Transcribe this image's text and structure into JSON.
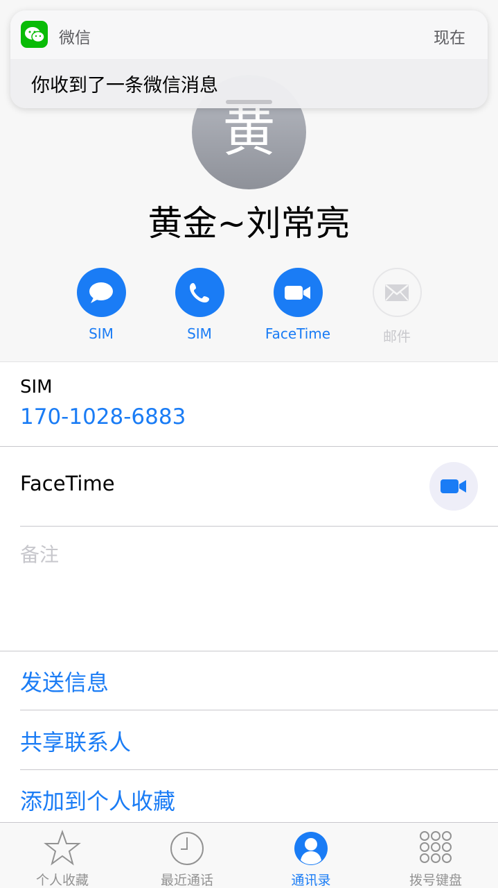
{
  "notification": {
    "app_name": "微信",
    "time": "现在",
    "message": "你收到了一条微信消息"
  },
  "contact": {
    "avatar_initial": "黄",
    "name": "黄金~刘常亮"
  },
  "quick_actions": [
    {
      "label": "SIM",
      "icon": "message-icon",
      "enabled": true
    },
    {
      "label": "SIM",
      "icon": "phone-icon",
      "enabled": true
    },
    {
      "label": "FaceTime",
      "icon": "video-camera-icon",
      "enabled": true
    },
    {
      "label": "邮件",
      "icon": "mail-icon",
      "enabled": false
    }
  ],
  "phone": {
    "type": "SIM",
    "number": "170-1028-6883"
  },
  "facetime": {
    "label": "FaceTime"
  },
  "notes": {
    "placeholder": "备注"
  },
  "actions": [
    {
      "label": "发送信息"
    },
    {
      "label": "共享联系人"
    },
    {
      "label": "添加到个人收藏"
    }
  ],
  "tabbar": {
    "tabs": [
      {
        "label": "个人收藏",
        "icon": "star-icon",
        "active": false
      },
      {
        "label": "最近通话",
        "icon": "clock-icon",
        "active": false
      },
      {
        "label": "通讯录",
        "icon": "contacts-icon",
        "active": true
      },
      {
        "label": "拨号键盘",
        "icon": "keypad-icon",
        "active": false
      }
    ]
  },
  "colors": {
    "accent": "#1a7cf5",
    "wechat_green": "#09bb07",
    "disabled": "#c8c8cc",
    "tab_inactive": "#929292"
  }
}
